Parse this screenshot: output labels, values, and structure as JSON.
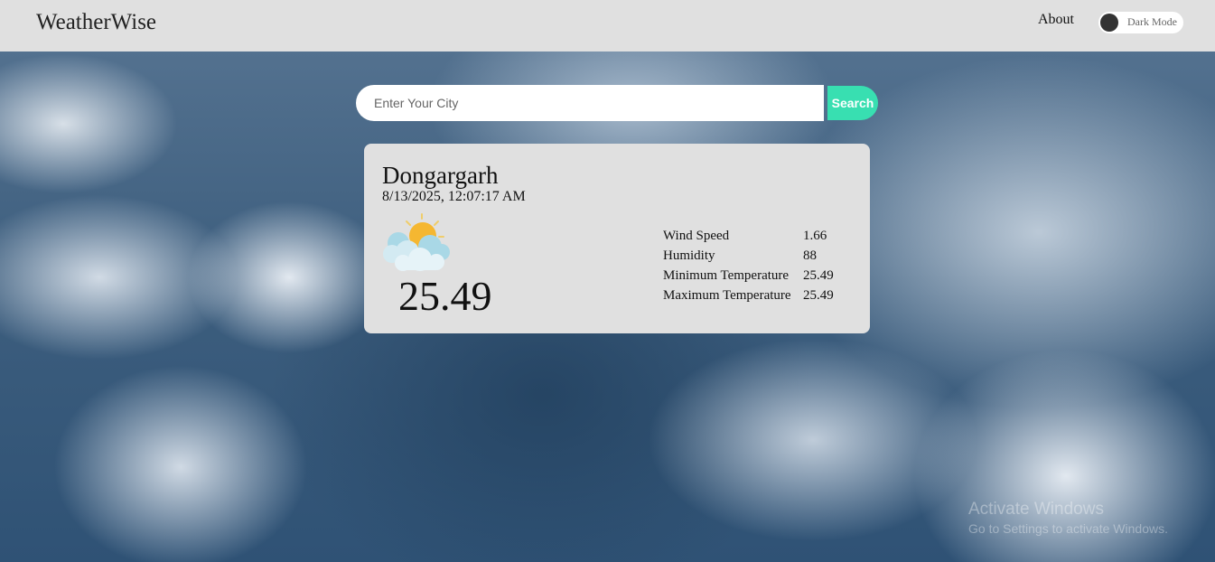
{
  "header": {
    "brand": "WeatherWise",
    "about_label": "About",
    "dark_mode_label": "Dark Mode"
  },
  "search": {
    "placeholder": "Enter Your City",
    "button_label": "Search"
  },
  "weather": {
    "city": "Dongargarh",
    "datetime": "8/13/2025, 12:07:17 AM",
    "icon": "partly-cloudy-sun-icon",
    "temperature": "25.49",
    "stats": [
      {
        "label": "Wind Speed",
        "value": "1.66"
      },
      {
        "label": "Humidity",
        "value": "88"
      },
      {
        "label": "Minimum Temperature",
        "value": "25.49"
      },
      {
        "label": "Maximum Temperature",
        "value": "25.49"
      }
    ]
  },
  "watermark": {
    "title": "Activate Windows",
    "subtitle": "Go to Settings to activate Windows."
  },
  "colors": {
    "header_bg": "#e0e0e0",
    "card_bg": "#e0e0e0",
    "search_accent": "#38dfb1",
    "toggle_knob": "#333333"
  }
}
